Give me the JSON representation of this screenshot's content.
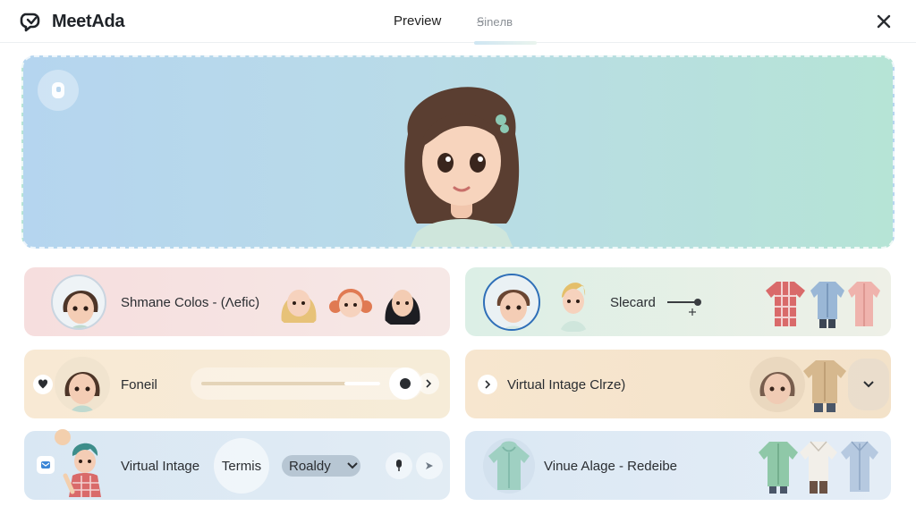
{
  "header": {
    "brand": "MeetAda",
    "tabs": [
      {
        "label": "Preview"
      },
      {
        "label": "Ꞩineлв"
      }
    ]
  },
  "cards": {
    "c1": {
      "label": "Shmane Colos - (Λefic)"
    },
    "c2": {
      "label": "Slecard"
    },
    "c3": {
      "label": "Foneil"
    },
    "c4": {
      "label": "Virtual Intage  Clrze)"
    },
    "c5": {
      "label": "Virtual Intage",
      "pill_label": "Termis",
      "dropdown_value": "Roaldy"
    },
    "c6": {
      "label": "Vinue Alage - Redeibe"
    }
  },
  "colors": {
    "accent_ring": "#2f6fb8",
    "hero_left": "#b5d5ef",
    "hero_right": "#b6e4d6"
  }
}
